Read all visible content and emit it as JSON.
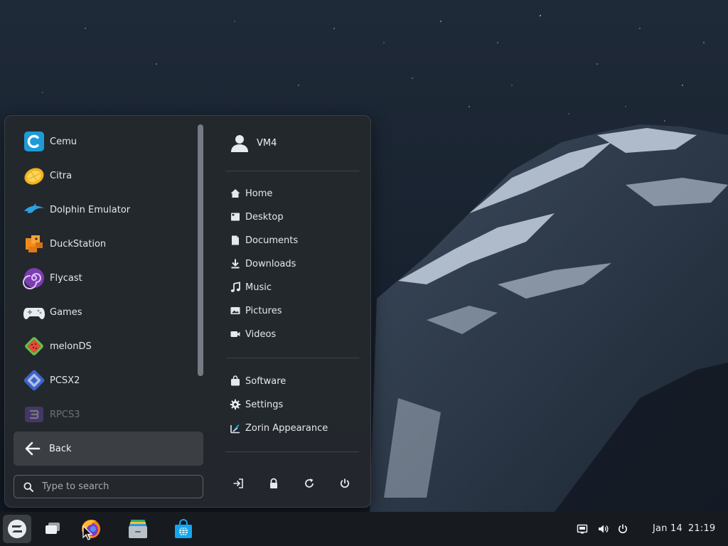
{
  "apps": [
    {
      "label": "Cemu",
      "icon": "cemu-icon"
    },
    {
      "label": "Citra",
      "icon": "citra-icon"
    },
    {
      "label": "Dolphin Emulator",
      "icon": "dolphin-icon"
    },
    {
      "label": "DuckStation",
      "icon": "duckstation-icon"
    },
    {
      "label": "Flycast",
      "icon": "flycast-icon"
    },
    {
      "label": "Games",
      "icon": "gamepad-icon"
    },
    {
      "label": "melonDS",
      "icon": "melonds-icon"
    },
    {
      "label": "PCSX2",
      "icon": "pcsx2-icon"
    },
    {
      "label": "RPCS3",
      "icon": "rpcs3-icon"
    }
  ],
  "back": {
    "label": "Back",
    "icon": "arrow-left-icon"
  },
  "search": {
    "placeholder": "Type to search",
    "value": "",
    "icon": "search-icon"
  },
  "user": {
    "name": "VM4",
    "icon": "user-icon"
  },
  "places": [
    {
      "label": "Home",
      "icon": "home-icon"
    },
    {
      "label": "Desktop",
      "icon": "desktop-icon"
    },
    {
      "label": "Documents",
      "icon": "document-icon"
    },
    {
      "label": "Downloads",
      "icon": "download-icon"
    },
    {
      "label": "Music",
      "icon": "music-icon"
    },
    {
      "label": "Pictures",
      "icon": "pictures-icon"
    },
    {
      "label": "Videos",
      "icon": "video-icon"
    }
  ],
  "system": [
    {
      "label": "Software",
      "icon": "software-bag-icon"
    },
    {
      "label": "Settings",
      "icon": "gear-icon"
    },
    {
      "label": "Zorin Appearance",
      "icon": "appearance-icon"
    }
  ],
  "session": [
    "logout-icon",
    "lock-icon",
    "restart-icon",
    "power-icon"
  ],
  "taskbar": {
    "apps": [
      "zorin-menu-icon",
      "workspaces-icon",
      "firefox-icon",
      "files-icon",
      "software-store-icon"
    ],
    "tray": [
      "network-icon",
      "volume-icon",
      "power-icon"
    ],
    "date": "Jan 14",
    "time": "21:19"
  },
  "colors": {
    "menu_bg": "#24282d",
    "accent": "#15a6f0",
    "taskbar_bg": "#181b1f"
  }
}
